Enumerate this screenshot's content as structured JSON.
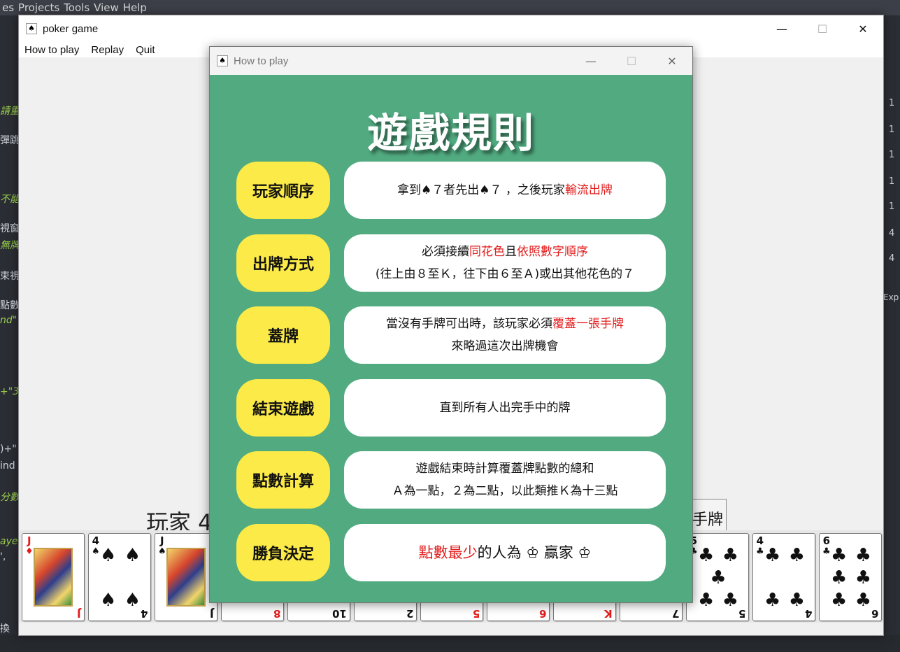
{
  "ide": {
    "menu": [
      "es",
      "Projects",
      "Tools",
      "View",
      "Help"
    ],
    "left_snippets": [
      "請重",
      "彈跳",
      "不能",
      "視窗",
      "無牌",
      "束視",
      "點數",
      "nd\"",
      "+\"3",
      ")+\"",
      "ind",
      "分數",
      "aye",
      "',",
      "換"
    ],
    "right_numbers": [
      "1",
      "1",
      "1",
      "1",
      "1",
      "4",
      "4"
    ],
    "right_label": "Exp"
  },
  "window": {
    "title": "poker game",
    "menu": {
      "how_to_play": "How to play",
      "replay": "Replay",
      "quit": "Quit"
    },
    "min": "—",
    "max": "☐",
    "close": "✕"
  },
  "table": {
    "player_label": "玩家 4",
    "action_button": "手牌"
  },
  "hand": [
    {
      "rank": "J",
      "suit": "♦",
      "color": "#e21b1b",
      "face": true
    },
    {
      "rank": "4",
      "suit": "♠",
      "color": "#111111",
      "face": false,
      "pips": 4
    },
    {
      "rank": "J",
      "suit": "♠",
      "color": "#111111",
      "face": true
    },
    {
      "rank": "8",
      "suit": "♥",
      "color": "#e21b1b"
    },
    {
      "rank": "10",
      "suit": "♠",
      "color": "#111111"
    },
    {
      "rank": "2",
      "suit": "♠",
      "color": "#111111"
    },
    {
      "rank": "5",
      "suit": "♦",
      "color": "#e21b1b"
    },
    {
      "rank": "6",
      "suit": "♦",
      "color": "#e21b1b"
    },
    {
      "rank": "K",
      "suit": "♦",
      "color": "#e21b1b"
    },
    {
      "rank": "7",
      "suit": "♠",
      "color": "#111111"
    },
    {
      "rank": "5",
      "suit": "♣",
      "color": "#111111",
      "pips": 5
    },
    {
      "rank": "4",
      "suit": "♣",
      "color": "#111111",
      "pips": 4
    },
    {
      "rank": "6",
      "suit": "♣",
      "color": "#111111",
      "pips": 6
    }
  ],
  "dialog": {
    "title": "How to play",
    "heading": "遊戲規則",
    "rules": [
      {
        "label": "玩家順序",
        "lines": [
          [
            "拿到♠７者先出♠７ ，之後玩家",
            "輸流出牌",
            ""
          ]
        ]
      },
      {
        "label": "出牌方式",
        "lines": [
          [
            "必須接續",
            "同花色",
            "且"
          ],
          [
            "",
            "依照數字順序",
            ""
          ],
          [
            "(往上由８至Ｋ，往下由６至Ａ)或出其他花色的７",
            "",
            ""
          ]
        ]
      },
      {
        "label": "蓋牌",
        "lines": [
          [
            "當沒有手牌可出時，該玩家必須",
            "覆蓋一張手牌",
            ""
          ],
          [
            "來略過這次出牌機會",
            "",
            ""
          ]
        ]
      },
      {
        "label": "結束遊戲",
        "lines": [
          [
            "直到所有人出完手中的牌",
            "",
            ""
          ]
        ]
      },
      {
        "label": "點數計算",
        "lines": [
          [
            "遊戲結束時計算覆蓋牌點數的總和",
            "",
            ""
          ],
          [
            "Ａ為一點，２為二點，以此類推Ｋ為十三點",
            "",
            ""
          ]
        ]
      },
      {
        "label": "勝負決定",
        "lines": [
          [
            "",
            "點數最少",
            "的人為 ♔ 贏家 ♔"
          ]
        ]
      }
    ]
  },
  "colors": {
    "dialog_bg": "#51aa80",
    "label_bg": "#fbea47",
    "highlight": "#e21b1b"
  }
}
